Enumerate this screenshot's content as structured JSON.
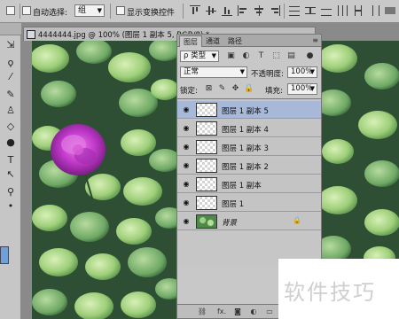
{
  "options_bar": {
    "auto_select_label": "自动选择:",
    "auto_select_value": "组",
    "show_transform_label": "显示变换控件"
  },
  "document": {
    "tab_title": "4444444.jpg @ 100% (图层 1 副本 5, RGB/8) *"
  },
  "layers_panel": {
    "tabs": [
      "图层",
      "通道",
      "路径"
    ],
    "filter_label": "ρ 类型",
    "blend_mode": "正常",
    "opacity_label": "不透明度:",
    "opacity_value": "100%",
    "lock_label": "锁定:",
    "fill_label": "填充:",
    "fill_value": "100%",
    "layers": [
      {
        "name": "图层 1 副本 5",
        "selected": true
      },
      {
        "name": "图层 1 副本 4",
        "selected": false
      },
      {
        "name": "图层 1 副本 3",
        "selected": false
      },
      {
        "name": "图层 1 副本 2",
        "selected": false
      },
      {
        "name": "图层 1 副本",
        "selected": false
      },
      {
        "name": "图层 1",
        "selected": false
      },
      {
        "name": "背景",
        "selected": false
      }
    ],
    "footer_fx": "fx."
  },
  "watermark": "软件技巧",
  "colors": {
    "selected_layer": "#a7b8d8",
    "flower": "#c23acb",
    "foreground_swatch": "#6fa1d8"
  }
}
